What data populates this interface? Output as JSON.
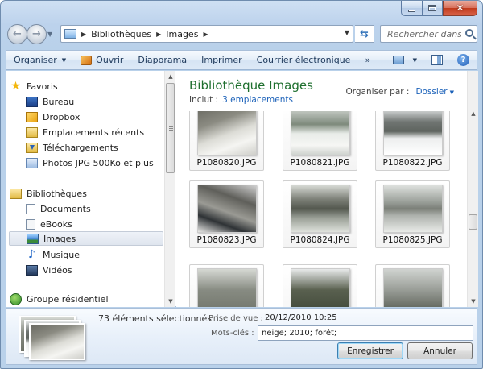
{
  "window": {
    "caption": {
      "minimize": "–",
      "maximize": "□",
      "close": "✕"
    }
  },
  "address": {
    "segments": [
      "Bibliothèques",
      "Images"
    ],
    "search_placeholder": "Rechercher dans : ..."
  },
  "toolbar": {
    "organize": "Organiser",
    "open": "Ouvrir",
    "slideshow": "Diaporama",
    "print": "Imprimer",
    "email": "Courrier électronique",
    "more": "»",
    "help": "?"
  },
  "nav": {
    "favorites": "Favoris",
    "favorite_items": [
      "Bureau",
      "Dropbox",
      "Emplacements récents",
      "Téléchargements",
      "Photos JPG 500Ko et plus"
    ],
    "libraries": "Bibliothèques",
    "library_items": [
      "Documents",
      "eBooks",
      "Images",
      "Musique",
      "Vidéos"
    ],
    "homegroup": "Groupe résidentiel"
  },
  "content": {
    "title": "Bibliothèque Images",
    "includes_label": "Inclut :",
    "includes_link": "3 emplacements",
    "arrange_label": "Organiser par :",
    "arrange_value": "Dossier",
    "files": [
      "P1080820.JPG",
      "P1080821.JPG",
      "P1080822.JPG",
      "P1080823.JPG",
      "P1080824.JPG",
      "P1080825.JPG",
      "",
      "",
      ""
    ]
  },
  "details": {
    "count": "73 éléments sélectionnés",
    "date_label": "Prise de vue :",
    "date_value": "20/12/2010 10:25",
    "keywords_label": "Mots-clés :",
    "keywords_value": "neige; 2010; forêt;",
    "save": "Enregistrer",
    "cancel": "Annuler"
  }
}
